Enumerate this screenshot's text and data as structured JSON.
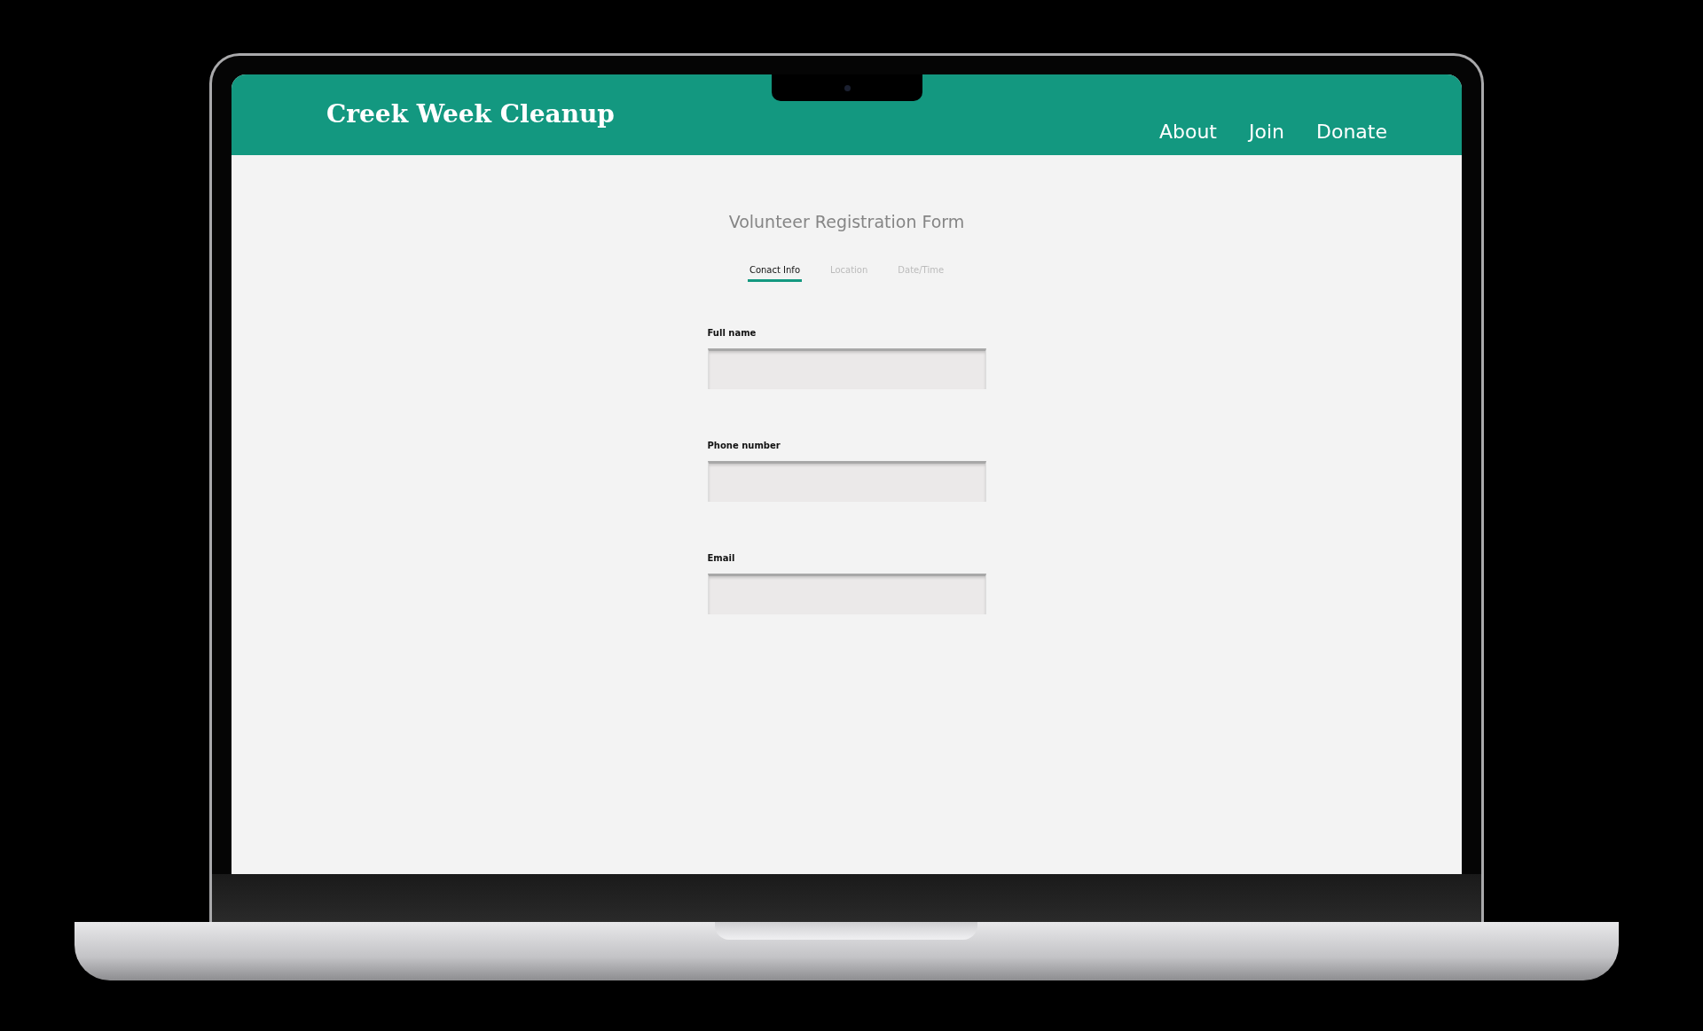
{
  "header": {
    "title": "Creek Week Cleanup",
    "nav": [
      {
        "label": "About"
      },
      {
        "label": "Join"
      },
      {
        "label": "Donate"
      }
    ]
  },
  "form": {
    "title": "Volunteer Registration Form",
    "tabs": [
      {
        "label": "Conact Info",
        "selected": true
      },
      {
        "label": "Location",
        "selected": false
      },
      {
        "label": "Date/Time",
        "selected": false
      }
    ],
    "fields": [
      {
        "label": "Full name"
      },
      {
        "label": "Phone number"
      },
      {
        "label": "Email"
      }
    ]
  }
}
